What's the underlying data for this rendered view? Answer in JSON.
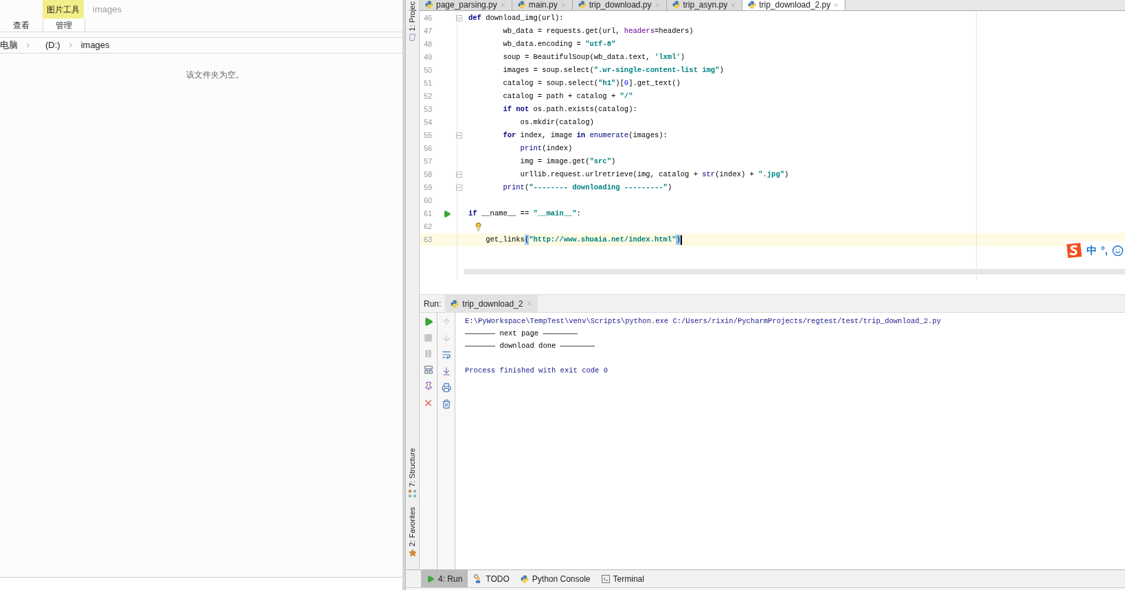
{
  "explorer": {
    "context_tab": "图片工具",
    "title": "images",
    "ribbon_tabs": [
      {
        "label": "查看",
        "selected": false
      },
      {
        "label": "管理",
        "selected": true
      }
    ],
    "breadcrumb": [
      "电脑",
      "(D:)",
      "images"
    ],
    "empty_message": "该文件夹为空。"
  },
  "ide": {
    "tool_windows_top": [
      {
        "label": "1: Projec",
        "kind": "project"
      }
    ],
    "tool_windows_bottom": [
      {
        "label": "7: Structure",
        "kind": "structure"
      },
      {
        "label": "2: Favorites",
        "kind": "favorites"
      }
    ],
    "editor_tabs": [
      {
        "label": "page_parsing.py",
        "selected": false
      },
      {
        "label": "main.py",
        "selected": false
      },
      {
        "label": "trip_download.py",
        "selected": false
      },
      {
        "label": "trip_asyn.py",
        "selected": false
      },
      {
        "label": "trip_download_2.py",
        "selected": true
      }
    ],
    "code_lines": [
      {
        "number": "46",
        "kind": "code",
        "fold": true,
        "current": false,
        "caret": false,
        "tokens": [
          {
            "kind": "kw",
            "text": "def"
          },
          {
            "kind": "p",
            "text": " download_img(url):"
          }
        ]
      },
      {
        "number": "47",
        "kind": "code",
        "fold": false,
        "current": false,
        "caret": false,
        "tokens": [
          {
            "kind": "p",
            "text": "        wb_data = requests.get(url, "
          },
          {
            "kind": "param",
            "text": "headers"
          },
          {
            "kind": "p",
            "text": "=headers)"
          }
        ]
      },
      {
        "number": "48",
        "kind": "code",
        "fold": false,
        "current": false,
        "caret": false,
        "tokens": [
          {
            "kind": "p",
            "text": "        wb_data.encoding = "
          },
          {
            "kind": "str",
            "text": "\"utf-8\""
          }
        ]
      },
      {
        "number": "49",
        "kind": "code",
        "fold": false,
        "current": false,
        "caret": false,
        "tokens": [
          {
            "kind": "p",
            "text": "        soup = BeautifulSoup(wb_data.text, "
          },
          {
            "kind": "str",
            "text": "'lxml'"
          },
          {
            "kind": "p",
            "text": ")"
          }
        ]
      },
      {
        "number": "50",
        "kind": "code",
        "fold": false,
        "current": false,
        "caret": false,
        "tokens": [
          {
            "kind": "p",
            "text": "        images = soup.select("
          },
          {
            "kind": "str",
            "text": "\".wr-single-content-list img\""
          },
          {
            "kind": "p",
            "text": ")"
          }
        ]
      },
      {
        "number": "51",
        "kind": "code",
        "fold": false,
        "current": false,
        "caret": false,
        "tokens": [
          {
            "kind": "p",
            "text": "        catalog = soup.select("
          },
          {
            "kind": "str",
            "text": "\"h1\""
          },
          {
            "kind": "p",
            "text": ")["
          },
          {
            "kind": "num",
            "text": "0"
          },
          {
            "kind": "p",
            "text": "].get_text()"
          }
        ]
      },
      {
        "number": "52",
        "kind": "code",
        "fold": false,
        "current": false,
        "caret": false,
        "tokens": [
          {
            "kind": "p",
            "text": "        catalog = path + catalog + "
          },
          {
            "kind": "str",
            "text": "\"/\""
          }
        ]
      },
      {
        "number": "53",
        "kind": "code",
        "fold": false,
        "current": false,
        "caret": false,
        "tokens": [
          {
            "kind": "kw",
            "text": "        if not"
          },
          {
            "kind": "p",
            "text": " os.path.exists(catalog):"
          }
        ]
      },
      {
        "number": "54",
        "kind": "code",
        "fold": false,
        "current": false,
        "caret": false,
        "tokens": [
          {
            "kind": "p",
            "text": "            os.mkdir(catalog)"
          }
        ]
      },
      {
        "number": "55",
        "kind": "code",
        "fold": true,
        "current": false,
        "caret": false,
        "tokens": [
          {
            "kind": "kw",
            "text": "        for"
          },
          {
            "kind": "p",
            "text": " index, image "
          },
          {
            "kind": "kw",
            "text": "in"
          },
          {
            "kind": "builtin",
            "text": " enumerate"
          },
          {
            "kind": "p",
            "text": "(images):"
          }
        ]
      },
      {
        "number": "56",
        "kind": "code",
        "fold": false,
        "current": false,
        "caret": false,
        "tokens": [
          {
            "kind": "builtin",
            "text": "            print"
          },
          {
            "kind": "p",
            "text": "(index)"
          }
        ]
      },
      {
        "number": "57",
        "kind": "code",
        "fold": false,
        "current": false,
        "caret": false,
        "tokens": [
          {
            "kind": "p",
            "text": "            img = image.get("
          },
          {
            "kind": "str",
            "text": "\"src\""
          },
          {
            "kind": "p",
            "text": ")"
          }
        ]
      },
      {
        "number": "58",
        "kind": "code",
        "fold": true,
        "current": false,
        "caret": false,
        "tokens": [
          {
            "kind": "p",
            "text": "            urllib.request.urlretrieve(img, catalog + "
          },
          {
            "kind": "builtin",
            "text": "str"
          },
          {
            "kind": "p",
            "text": "(index) + "
          },
          {
            "kind": "str",
            "text": "\".jpg\""
          },
          {
            "kind": "p",
            "text": ")"
          }
        ]
      },
      {
        "number": "59",
        "kind": "code",
        "fold": true,
        "current": false,
        "caret": false,
        "tokens": [
          {
            "kind": "builtin",
            "text": "        print"
          },
          {
            "kind": "p",
            "text": "("
          },
          {
            "kind": "str",
            "text": "\"-------- downloading ---------\""
          },
          {
            "kind": "p",
            "text": ")"
          }
        ]
      },
      {
        "number": "60",
        "kind": "blank",
        "fold": false,
        "current": false,
        "caret": false
      },
      {
        "number": "61",
        "kind": "run",
        "fold": false,
        "current": false,
        "caret": false,
        "tokens": [
          {
            "kind": "kw",
            "text": "if"
          },
          {
            "kind": "p",
            "text": " __name__ == "
          },
          {
            "kind": "str",
            "text": "\"__main__\""
          },
          {
            "kind": "p",
            "text": ":"
          }
        ]
      },
      {
        "number": "62",
        "kind": "bulb",
        "fold": false,
        "current": false,
        "caret": false
      },
      {
        "number": "63",
        "kind": "code",
        "fold": false,
        "current": true,
        "caret": true,
        "tokens": [
          {
            "kind": "p",
            "text": "    get_links"
          },
          {
            "kind": "match",
            "text": "("
          },
          {
            "kind": "str",
            "text": "\"http://www.shuaia.net/index.html\""
          },
          {
            "kind": "match",
            "text": ")"
          }
        ]
      }
    ],
    "run": {
      "label": "Run:",
      "tab": "trip_download_2"
    },
    "console": [
      {
        "kind": "command",
        "text": "E:\\PyWorkspace\\TempTest\\venv\\Scripts\\python.exe C:/Users/rixin/PycharmProjects/regtest/test/trip_download_2.py"
      },
      {
        "kind": "output",
        "text": "——————— next page ————————"
      },
      {
        "kind": "output",
        "text": "——————— download done ————————"
      },
      {
        "kind": "blank"
      },
      {
        "kind": "exit",
        "text": "Process finished with exit code 0"
      }
    ],
    "bottom_tabs": [
      {
        "label": "4: Run",
        "kind": "run",
        "selected": true
      },
      {
        "label": "TODO",
        "kind": "todo",
        "selected": false
      },
      {
        "label": "Python Console",
        "kind": "python",
        "selected": false
      },
      {
        "label": "Terminal",
        "kind": "terminal",
        "selected": false
      }
    ],
    "ime": {
      "chars": [
        "中",
        "°,"
      ]
    }
  }
}
